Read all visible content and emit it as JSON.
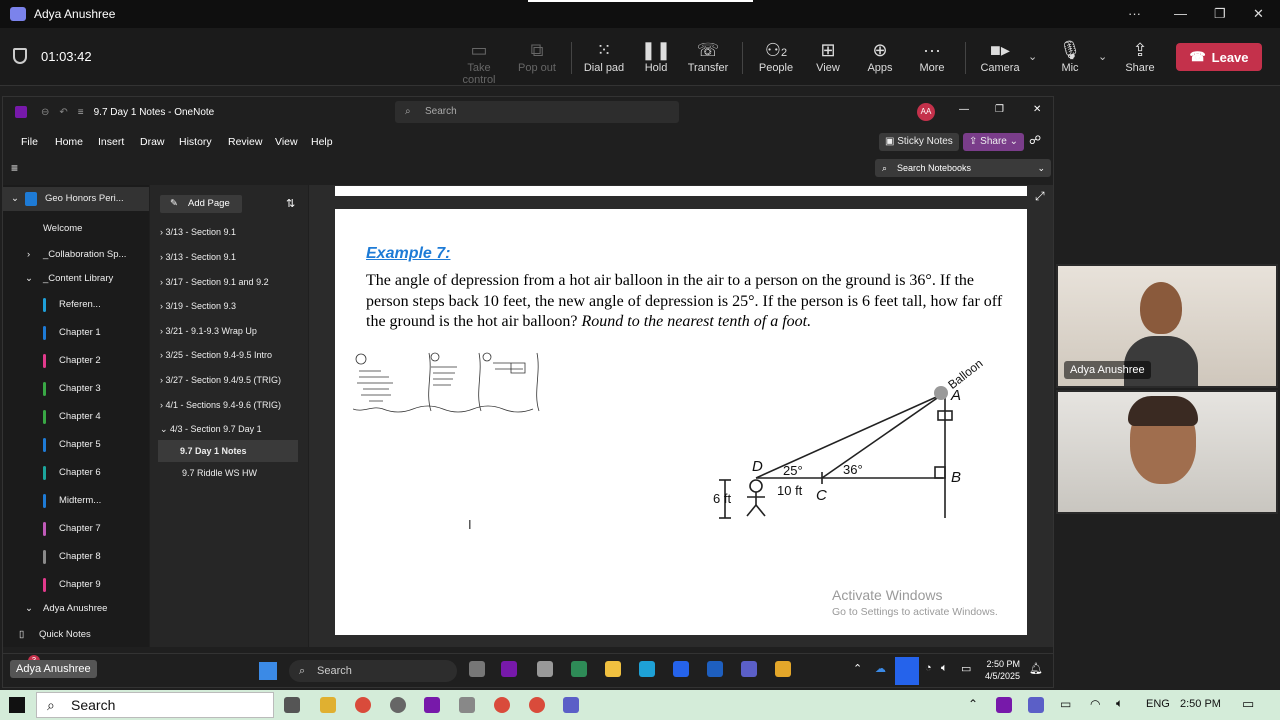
{
  "teams": {
    "title": "Adya Anushree",
    "timer": "01:03:42",
    "toolbar": [
      {
        "label": "Take control",
        "icon": "take-control-icon"
      },
      {
        "label": "Pop out",
        "icon": "pop-out-icon"
      },
      {
        "label": "Dial pad",
        "icon": "dial-pad-icon"
      },
      {
        "label": "Hold",
        "icon": "hold-icon"
      },
      {
        "label": "Transfer",
        "icon": "transfer-icon"
      },
      {
        "label": "People",
        "icon": "people-icon",
        "count": "2"
      },
      {
        "label": "View",
        "icon": "view-icon"
      },
      {
        "label": "Apps",
        "icon": "apps-icon"
      },
      {
        "label": "More",
        "icon": "more-icon"
      },
      {
        "label": "Camera",
        "icon": "camera-icon"
      },
      {
        "label": "Mic",
        "icon": "mic-icon"
      },
      {
        "label": "Share",
        "icon": "share-icon"
      }
    ],
    "leave_label": "Leave",
    "participants": [
      {
        "name": "Adya Anushree"
      }
    ],
    "self_label": "Adya Anushree",
    "colors": {
      "leave": "#c4314b",
      "accent": "#7b83eb"
    }
  },
  "onenote": {
    "title": "9.7 Day 1 Notes - OneNote",
    "search_placeholder": "Search",
    "avatar": "AA",
    "menu": [
      "File",
      "Home",
      "Insert",
      "Draw",
      "History",
      "Review",
      "View",
      "Help"
    ],
    "sticky_notes": "Sticky Notes",
    "share": "Share",
    "search_notebooks": "Search Notebooks",
    "notebook": "Geo Honors Peri...",
    "sections": [
      {
        "label": "Welcome",
        "color": "#c05ab8"
      },
      {
        "label": "_Collaboration Sp...",
        "color": ""
      },
      {
        "label": "_Content Library",
        "color": ""
      },
      {
        "label": "Referen...",
        "color": "#1e9fd8"
      },
      {
        "label": "Chapter 1",
        "color": "#1e7bd6"
      },
      {
        "label": "Chapter 2",
        "color": "#e23a8c"
      },
      {
        "label": "Chapter 3",
        "color": "#39a845"
      },
      {
        "label": "Chapter 4",
        "color": "#39a845"
      },
      {
        "label": "Chapter 5",
        "color": "#1e7bd6"
      },
      {
        "label": "Chapter 6",
        "color": "#1ca59c"
      },
      {
        "label": "Midterm...",
        "color": "#1e7bd6"
      },
      {
        "label": "Chapter 7",
        "color": "#c05ab8"
      },
      {
        "label": "Chapter 8",
        "color": "#8a8a8a"
      },
      {
        "label": "Chapter 9",
        "color": "#e23a8c"
      },
      {
        "label": "Adya Anushree",
        "color": ""
      }
    ],
    "quick_notes": "Quick Notes",
    "add_page": "Add Page",
    "pages": [
      "3/13 - Section 9.1",
      "3/13 - Section 9.1",
      "3/17 - Section 9.1 and 9.2",
      "3/19 - Section 9.3",
      "3/21 - 9.1-9.3 Wrap Up",
      "3/25 - Section 9.4-9.5 Intro",
      "3/27 - Section 9.4/9.5 (TRIG)",
      "4/1 - Sections 9.4-9.6 (TRIG)",
      "4/3 - Section 9.7 Day 1",
      "9.7 Day 1 Notes",
      "9.7 Riddle WS HW"
    ],
    "note": {
      "example_title": "Example 7:",
      "problem_text": "The angle of depression from a hot air balloon in the air to a person on the ground is 36°. If the person steps back 10 feet, the new angle of depression is 25°. If the person is 6 feet tall, how far off the ground is the hot air balloon?",
      "problem_italic": "Round to the nearest tenth of a foot.",
      "diagram": {
        "balloon": "Balloon",
        "A": "A",
        "B": "B",
        "C": "C",
        "D": "D",
        "angle_d": "25°",
        "angle_c": "36°",
        "distance": "10 ft",
        "height": "6 ft"
      }
    },
    "watermark": {
      "line1": "Activate Windows",
      "line2": "Go to Settings to activate Windows."
    },
    "inner_taskbar": {
      "search": "Search",
      "time": "2:50 PM",
      "date": "4/5/2025",
      "badge": "3",
      "self_tag": "Adya Anushree"
    }
  },
  "windows_taskbar": {
    "search": "Search",
    "language": "ENG",
    "time": "2:50 PM"
  }
}
